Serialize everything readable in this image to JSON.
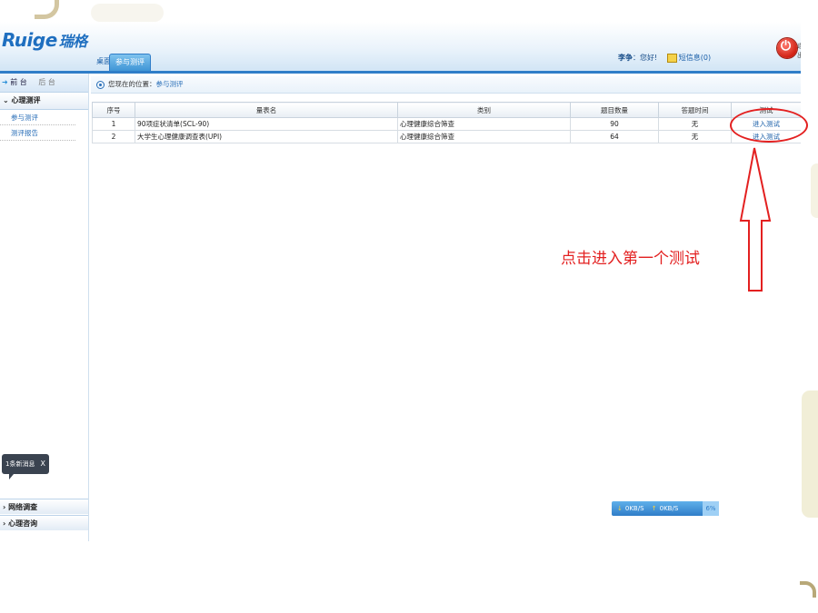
{
  "header": {
    "logo_latin": "Ruige",
    "logo_cn": "瑞格",
    "tabs": [
      {
        "label": "桌面"
      },
      {
        "label": "参与测评"
      }
    ],
    "user_name": "李争",
    "greeting": "：您好!",
    "messages_label": "短信息(0)",
    "exit_text": "退出"
  },
  "sidebar": {
    "forward_label": "前 台",
    "back_label": "后 台",
    "section": "心理测评",
    "items": [
      {
        "label": "参与测评"
      },
      {
        "label": "测评报告"
      }
    ],
    "toast": "1条新消息",
    "toast_close": "X",
    "bottom_sections": [
      {
        "label": "网络调查"
      },
      {
        "label": "心理咨询"
      }
    ]
  },
  "breadcrumb": {
    "prefix": "您现在的位置：",
    "location": "参与测评"
  },
  "table": {
    "headers": [
      "序号",
      "量表名",
      "类别",
      "题目数量",
      "答题时间",
      "测试"
    ],
    "rows": [
      {
        "no": "1",
        "name": "90项症状清单(SCL-90)",
        "category": "心理健康综合筛查",
        "count": "90",
        "time": "无",
        "action": "进入测试"
      },
      {
        "no": "2",
        "name": "大学生心理健康调查表(UPI)",
        "category": "心理健康综合筛查",
        "count": "64",
        "time": "无",
        "action": "进入测试"
      }
    ]
  },
  "status_bar": {
    "down": "0KB/S",
    "up": "0KB/S",
    "percent": "6%"
  },
  "annotation": {
    "text": "点击进入第一个测试",
    "color": "#e32020"
  }
}
